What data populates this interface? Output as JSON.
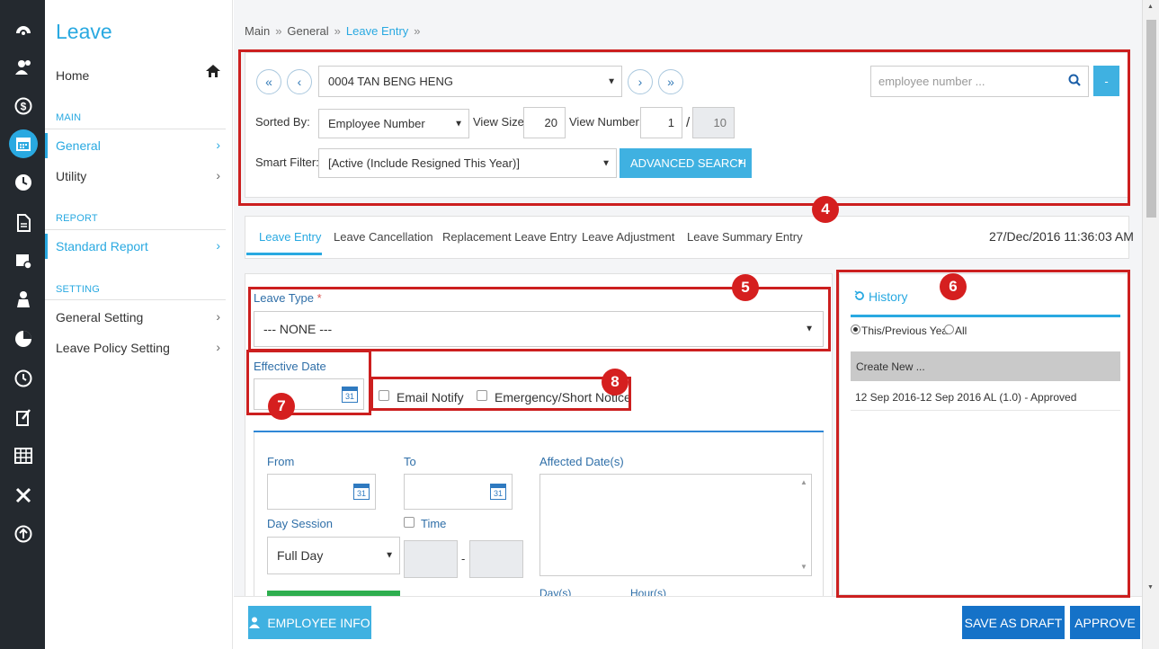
{
  "rail": {
    "icons": [
      "dashboard-icon",
      "user-money-icon",
      "dollar-icon",
      "calendar-icon",
      "clock-icon",
      "document-icon",
      "calendar-alert-icon",
      "user-icon",
      "pie-chart-icon",
      "timer-icon",
      "edit-doc-icon",
      "table-icon",
      "tools-icon",
      "upload-icon"
    ]
  },
  "sidebar": {
    "title": "Leave",
    "home": "Home",
    "main_section": "MAIN",
    "general": "General",
    "utility": "Utility",
    "report_section": "REPORT",
    "standard_report": "Standard Report",
    "setting_section": "SETTING",
    "general_setting": "General Setting",
    "leave_policy_setting": "Leave Policy Setting"
  },
  "breadcrumb": {
    "main": "Main",
    "general": "General",
    "current": "Leave Entry"
  },
  "employee_panel": {
    "employee_selected": "0004 TAN BENG HENG",
    "search_placeholder": "employee number ...",
    "sorted_by_label": "Sorted By:",
    "sorted_by_value": "Employee Number",
    "view_size_label": "View Size:",
    "view_size_value": "20",
    "view_number_label": "View Number:",
    "view_number_value": "1",
    "view_number_sep": "/",
    "view_number_total": "10",
    "smart_filter_label": "Smart Filter:",
    "smart_filter_value": "[Active (Include Resigned This Year)]",
    "advanced_search": "ADVANCED SEARCH",
    "minus_button": "-"
  },
  "tabs": [
    "Leave Entry",
    "Leave Cancellation",
    "Replacement Leave Entry",
    "Leave Adjustment",
    "Leave Summary Entry"
  ],
  "datetime": "27/Dec/2016 11:36:03 AM",
  "form": {
    "leave_type_label": "Leave Type",
    "required_mark": "*",
    "leave_type_value": "--- NONE ---",
    "effective_date_label": "Effective Date",
    "email_notify": "Email Notify",
    "emergency_notice": "Emergency/Short Notice",
    "from_label": "From",
    "to_label": "To",
    "affected_dates_label": "Affected Date(s)",
    "day_session_label": "Day Session",
    "day_session_value": "Full Day",
    "time_label": "Time",
    "time_sep": "-",
    "days_label": "Day(s)",
    "hours_label": "Hour(s)",
    "cal_day": "31"
  },
  "history": {
    "title": "History",
    "option_this_prev": "This/Previous Year",
    "option_all": "All",
    "create_new": "Create New ...",
    "entries": [
      "12 Sep 2016-12 Sep 2016 AL (1.0) - Approved"
    ]
  },
  "footer": {
    "employee_info": "EMPLOYEE INFO",
    "save_as_draft": "SAVE AS DRAFT",
    "approve": "APPROVE"
  },
  "markers": [
    "4",
    "5",
    "6",
    "7",
    "8"
  ],
  "colors": {
    "accent": "#29a9e1",
    "annotation": "#cc1f1f",
    "primary_button": "#1572c8",
    "rail": "#24292f"
  }
}
